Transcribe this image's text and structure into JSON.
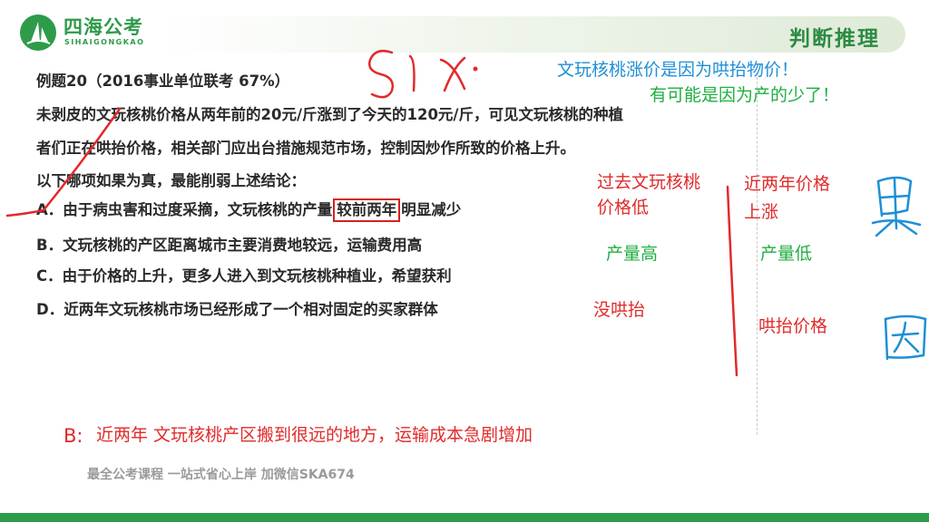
{
  "logo": {
    "name": "四海公考",
    "sub": "SIHAIGONGKAO"
  },
  "header": {
    "title": "判断推理"
  },
  "question": {
    "heading": "例题20（2016事业单位联考 67%）",
    "body_line1": "未剥皮的文玩核桃价格从两年前的20元/斤涨到了今天的120元/斤，可见文玩核桃的种植",
    "body_line2": "者们正在哄抬价格，相关部门应出台措施规范市场，控制因炒作所致的价格上升。",
    "prompt": "以下哪项如果为真，最能削弱上述结论：",
    "options": {
      "a_pre": "A．由于病虫害和过度采摘，文玩核桃的产量",
      "a_boxed": "较前两年",
      "a_post": "明显减少",
      "b": "B．文玩核桃的产区距离城市主要消费地较远，运输费用高",
      "c": "C．由于价格的上升，更多人进入到文玩核桃种植业，希望获利",
      "d": "D．近两年文玩核桃市场已经形成了一个相对固定的买家群体"
    }
  },
  "annotations": {
    "blue_note": "文玩核桃涨价是因为哄抬物价！",
    "green_note": "有可能是因为产的少了！",
    "left_col_line1": "过去文玩核桃",
    "left_col_line2": "价格低",
    "left_col_mid": "产量高",
    "left_col_low": "没哄抬",
    "right_col_line1": "近两年价格",
    "right_col_line2": "上涨",
    "right_col_mid": "产量低",
    "right_col_low": "哄抬价格",
    "b_label": "B:",
    "b_note": "近两年 文玩核桃产区搬到很远的地方，运输成本急剧增加"
  },
  "footer": {
    "ad": "最全公考课程 一站式省心上岸 加微信SKA674"
  },
  "colors": {
    "brand_green": "#2e9b4a",
    "ink_red": "#e12a2a",
    "ink_blue": "#1e8fd6",
    "ink_green": "#1fae3f"
  }
}
